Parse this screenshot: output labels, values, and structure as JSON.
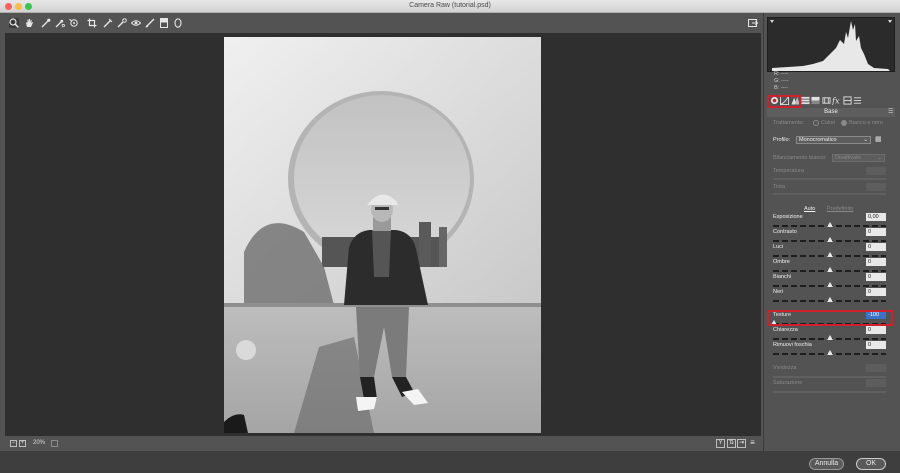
{
  "window": {
    "title": "Camera Raw (tutorial.psd)"
  },
  "toolbar": {
    "tools": [
      "zoom-tool-icon",
      "hand-tool-icon",
      "white-balance-icon",
      "color-sampler-icon",
      "targeted-adjustment-icon",
      "crop-icon",
      "straighten-icon",
      "spot-removal-icon",
      "red-eye-icon",
      "adjustment-brush-icon",
      "graduated-filter-icon",
      "radial-filter-icon"
    ]
  },
  "status": {
    "zoom": "20%"
  },
  "histogram": {
    "r_label": "R:",
    "g_label": "G:",
    "b_label": "B:",
    "r": "----",
    "g": "----",
    "b": "----"
  },
  "panel": {
    "section_title": "Base",
    "treatment_label": "Trattamento:",
    "treatment_color": "Colori",
    "treatment_bw": "Bianco e nero",
    "profile_label": "Profilo:",
    "profile_value": "Monocromatico",
    "wb_label": "Bilanciamento bianco:",
    "wb_value": "Disattivato",
    "temperature_label": "Temperatura",
    "tint_label": "Tinta",
    "auto_label": "Auto",
    "defaults_label": "Predefinito",
    "sliders": [
      {
        "label": "Esposizione",
        "value": "0,00"
      },
      {
        "label": "Contrasto",
        "value": "0"
      },
      {
        "label": "Luci",
        "value": "0"
      },
      {
        "label": "Ombre",
        "value": "0"
      },
      {
        "label": "Bianchi",
        "value": "0"
      },
      {
        "label": "Neri",
        "value": "0"
      },
      {
        "label": "Texture",
        "value": "-100"
      },
      {
        "label": "Chiarezza",
        "value": "0"
      },
      {
        "label": "Rimuovi foschia",
        "value": "0"
      },
      {
        "label": "Vividezza",
        "value": ""
      },
      {
        "label": "Saturazione",
        "value": ""
      }
    ]
  },
  "footer": {
    "cancel": "Annulla",
    "ok": "OK"
  },
  "colors": {
    "highlight": "#d0202a",
    "selected_value": "#3b73c9"
  }
}
